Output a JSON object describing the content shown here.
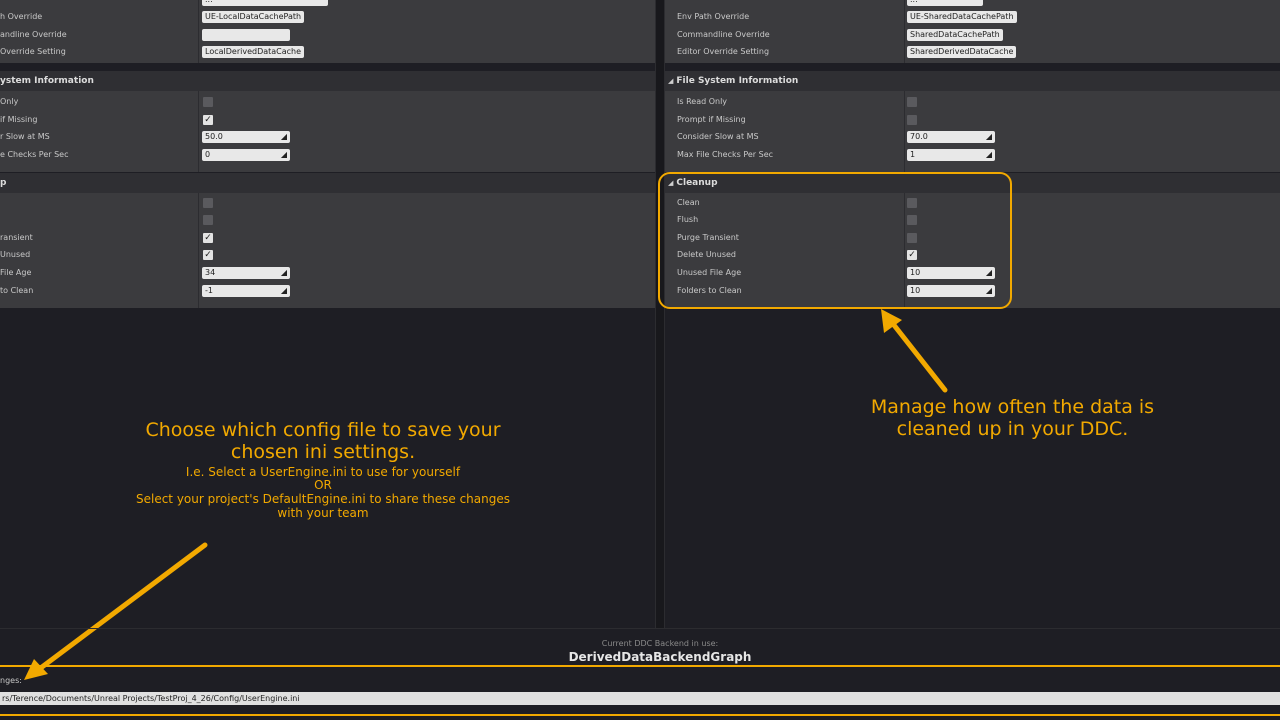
{
  "left": {
    "top_rows": [
      {
        "label": "h Override",
        "value": "UE-LocalDataCachePath"
      },
      {
        "label": "andline Override",
        "value": ""
      },
      {
        "label": "Override Setting",
        "value": "LocalDerivedDataCache"
      }
    ],
    "fs_section": {
      "title": "ystem Information"
    },
    "fs_rows": [
      {
        "label": "Only",
        "type": "check",
        "checked": false
      },
      {
        "label": "if Missing",
        "type": "check",
        "checked": true
      },
      {
        "label": "r Slow at MS",
        "type": "num",
        "value": "50.0"
      },
      {
        "label": "e Checks Per Sec",
        "type": "num",
        "value": "0"
      }
    ],
    "cleanup_section": {
      "title": "p"
    },
    "cleanup_rows": [
      {
        "label": "",
        "type": "check",
        "checked": false
      },
      {
        "label": "",
        "type": "check",
        "checked": false
      },
      {
        "label": "ransient",
        "type": "check",
        "checked": true
      },
      {
        "label": "Unused",
        "type": "check",
        "checked": true
      },
      {
        "label": "File Age",
        "type": "num",
        "value": "34"
      },
      {
        "label": "to Clean",
        "type": "num",
        "value": "-1"
      }
    ]
  },
  "right": {
    "top_rows": [
      {
        "label": "Env Path Override",
        "value": "UE-SharedDataCachePath"
      },
      {
        "label": "Commandline Override",
        "value": "SharedDataCachePath"
      },
      {
        "label": "Editor Override Setting",
        "value": "SharedDerivedDataCache"
      }
    ],
    "fs_section": {
      "title": "File System Information"
    },
    "fs_rows": [
      {
        "label": "Is Read Only",
        "type": "check",
        "checked": false
      },
      {
        "label": "Prompt if Missing",
        "type": "check",
        "checked": false
      },
      {
        "label": "Consider Slow at MS",
        "type": "num",
        "value": "70.0"
      },
      {
        "label": "Max File Checks Per Sec",
        "type": "num",
        "value": "1"
      }
    ],
    "cleanup_section": {
      "title": "Cleanup"
    },
    "cleanup_rows": [
      {
        "label": "Clean",
        "type": "check",
        "checked": false
      },
      {
        "label": "Flush",
        "type": "check",
        "checked": false
      },
      {
        "label": "Purge Transient",
        "type": "check",
        "checked": false
      },
      {
        "label": "Delete Unused",
        "type": "check",
        "checked": true
      },
      {
        "label": "Unused File Age",
        "type": "num",
        "value": "10"
      },
      {
        "label": "Folders to Clean",
        "type": "num",
        "value": "10"
      }
    ]
  },
  "annotations": {
    "right_note_line1": "Manage how often the data is",
    "right_note_line2": "cleaned up in your DDC.",
    "left_note_line1": "Choose which config file to save your",
    "left_note_line2": "chosen ini settings.",
    "left_note_line3": "I.e. Select a UserEngine.ini to use for yourself",
    "left_note_line4": "OR",
    "left_note_line5": "Select your project's DefaultEngine.ini to share these changes",
    "left_note_line6": "with your team"
  },
  "footer": {
    "backend_caption": "Current DDC Backend in use:",
    "backend_name": "DerivedDataBackendGraph",
    "save_label": "nges:",
    "config_path": "rs/Terence/Documents/Unreal Projects/TestProj_4_26/Config/UserEngine.ini"
  },
  "colors": {
    "accent": "#f2a900",
    "panel": "#3b3b3e",
    "header": "#2f2f33",
    "background": "#1e1e24"
  }
}
